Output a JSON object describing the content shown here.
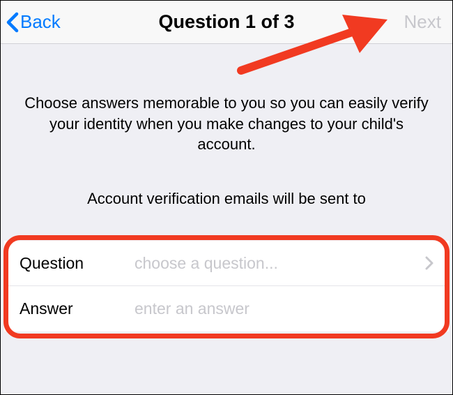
{
  "nav": {
    "back_label": "Back",
    "title": "Question 1 of 3",
    "next_label": "Next"
  },
  "content": {
    "instruction": "Choose answers memorable to you so you can easily verify your identity when you make changes to your child's account.",
    "email_notice": "Account verification emails will be sent to"
  },
  "form": {
    "question_label": "Question",
    "question_placeholder": "choose a question...",
    "answer_label": "Answer",
    "answer_placeholder": "enter an answer"
  },
  "colors": {
    "ios_blue": "#007aff",
    "disabled_gray": "#c7c7cc",
    "annotation_red": "#f13a21"
  }
}
